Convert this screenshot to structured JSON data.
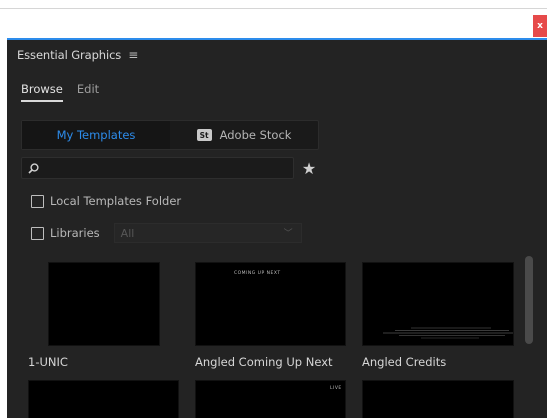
{
  "window": {
    "close_label": "x"
  },
  "panel": {
    "title": "Essential Graphics",
    "menu_icon": "hamburger-icon"
  },
  "subtabs": [
    {
      "label": "Browse",
      "active": true
    },
    {
      "label": "Edit",
      "active": false
    }
  ],
  "source": {
    "my_templates": "My Templates",
    "adobe_stock": "Adobe Stock",
    "stock_logo_text": "St"
  },
  "search": {
    "value": "",
    "placeholder": ""
  },
  "options": {
    "local_templates": "Local Templates Folder",
    "libraries": "Libraries",
    "libraries_dropdown": "All"
  },
  "templates": [
    {
      "name": "1-UNIC"
    },
    {
      "name": "Angled Coming Up Next",
      "thumb_text": "COMING UP NEXT"
    },
    {
      "name": "Angled Credits"
    },
    {
      "name": ""
    },
    {
      "name": "",
      "thumb_text": "LIVE"
    },
    {
      "name": ""
    }
  ],
  "colors": {
    "accent": "#2d8ceb",
    "panel_bg": "#232323",
    "close_bg": "#e64a4a"
  }
}
